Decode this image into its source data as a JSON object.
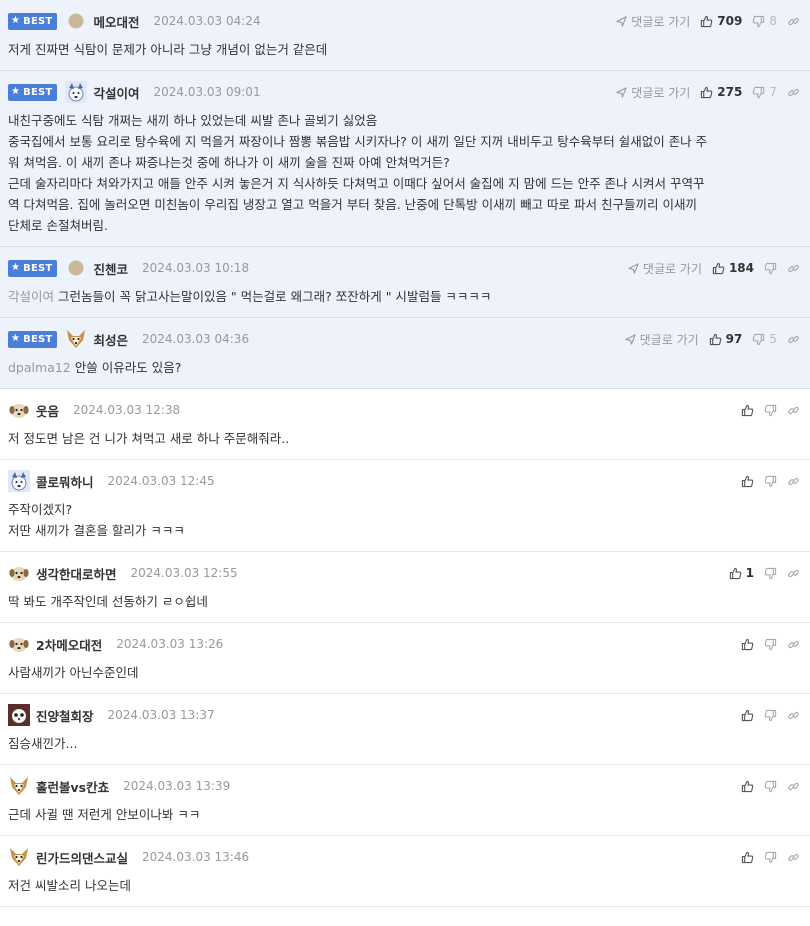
{
  "best_label": "BEST",
  "goto_label": "댓글로 가기",
  "comments": [
    {
      "nick": "메오대전",
      "time": "2024.03.03 04:24",
      "up": "709",
      "down": "8",
      "avatar": "plain",
      "lines": [
        "저게 진짜면 식탐이 문제가 아니라 그냥 개념이 없는거 같은데"
      ]
    },
    {
      "nick": "각설이여",
      "time": "2024.03.03 09:01",
      "up": "275",
      "down": "7",
      "avatar": "dog",
      "lines": [
        "내친구중에도 식탐 개쩌는 새끼 하나 있었는데 씨발 존나 골뵈기 싫었음",
        "중국집에서 보통 요리로 탕수육에 지 먹을거 짜장이나 짬뽕 볶음밥 시키자나? 이 새끼 일단 지꺼 내비두고 탕수육부터 쉴새없이 존나 주",
        "워 쳐먹음. 이 새끼 존나 짜증나는것 중에 하나가 이 새끼 술을 진짜 아예 안쳐먹거든?",
        "근데 술자리마다 쳐와가지고 애들 안주 시켜 놓은거 지 식사하듯 다쳐먹고 이때다 싶어서 술집에 지 맘에 드는 안주 존나 시켜서 꾸역꾸",
        "역 다쳐먹음. 집에 놀러오면 미친놈이 우리집 냉장고 열고 먹을거 부터 찾음. 난중에 단톡방 이새끼 빼고 따로 파서 친구들끼리 이새끼",
        "단체로 손절쳐버림."
      ]
    },
    {
      "nick": "진첸코",
      "time": "2024.03.03 10:18",
      "up": "184",
      "down": "",
      "avatar": "plain",
      "reply": "각설이여",
      "lines": [
        "그런놈들이 꼭 닭고사는말이있음 \" 먹는걸로 왜그래? 쪼잔하게 \" 시발럼들 ㅋㅋㅋㅋ"
      ]
    },
    {
      "nick": "최성은",
      "time": "2024.03.03 04:36",
      "up": "97",
      "down": "5",
      "avatar": "fox",
      "reply": "dpalma12",
      "lines": [
        "안쓸 이유라도 있음?"
      ]
    },
    {
      "nick": "웃음",
      "time": "2024.03.03 12:38",
      "up": "",
      "down": "",
      "avatar": "puppy",
      "lines": [
        "저 정도면 남은 건 니가 쳐먹고 새로 하나 주문해줘라.."
      ]
    },
    {
      "nick": "콜로뭐하니",
      "time": "2024.03.03 12:45",
      "up": "",
      "down": "",
      "avatar": "dog",
      "lines": [
        "주작이겠지?",
        "저딴 새끼가 결혼을 할리가 ㅋㅋㅋ"
      ]
    },
    {
      "nick": "생각한대로하면",
      "time": "2024.03.03 12:55",
      "up": "1",
      "down": "",
      "avatar": "puppy",
      "lines": [
        "딱 봐도 개주작인데 선동하기 ㄹㅇ쉽네"
      ]
    },
    {
      "nick": "2차메오대전",
      "time": "2024.03.03 13:26",
      "up": "",
      "down": "",
      "avatar": "puppy",
      "lines": [
        "사람새끼가 아닌수준인데"
      ]
    },
    {
      "nick": "진양철회장",
      "time": "2024.03.03 13:37",
      "up": "",
      "down": "",
      "avatar": "panda",
      "lines": [
        "짐승새낀가..."
      ]
    },
    {
      "nick": "홀런볼vs칸쵸",
      "time": "2024.03.03 13:39",
      "up": "",
      "down": "",
      "avatar": "fox",
      "lines": [
        "근데 사귈 땐 저런게 안보이나봐 ㅋㅋ"
      ]
    },
    {
      "nick": "린가드의댄스교실",
      "time": "2024.03.03 13:46",
      "up": "",
      "down": "",
      "avatar": "fox",
      "lines": [
        "저건 씨발소리 나오는데"
      ]
    }
  ],
  "colors": {
    "best_bg": "#eef2fb",
    "badge": "#4a7fd9",
    "border": "#e3e6ea"
  }
}
